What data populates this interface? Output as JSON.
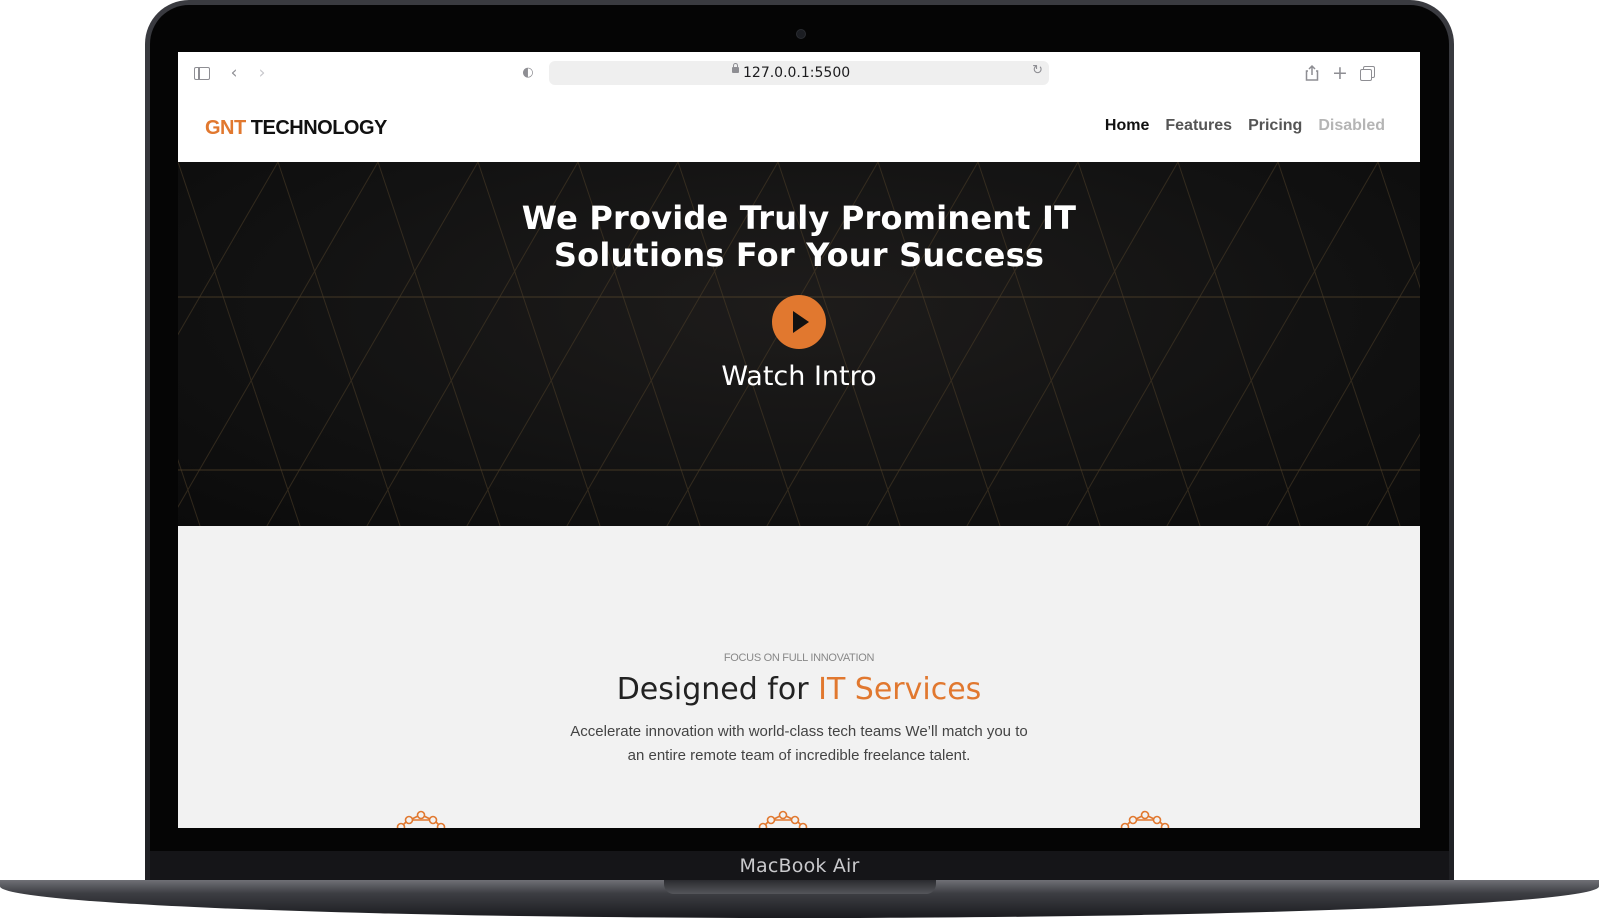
{
  "device": {
    "label": "MacBook Air"
  },
  "browser": {
    "url": "127.0.0.1:5500",
    "icons": [
      "sidebar-icon",
      "back-icon",
      "forward-icon",
      "shield-icon",
      "lock-icon",
      "reload-icon",
      "share-icon",
      "new-tab-icon",
      "tabs-overview-icon"
    ]
  },
  "navbar": {
    "logo_accent": "GNT",
    "logo_rest": " TECHNOLOGY",
    "links": [
      {
        "label": "Home",
        "state": "active"
      },
      {
        "label": "Features",
        "state": "default"
      },
      {
        "label": "Pricing",
        "state": "default"
      },
      {
        "label": "Disabled",
        "state": "disabled"
      }
    ]
  },
  "hero": {
    "title_line1": "We Provide Truly Prominent IT",
    "title_line2": "Solutions For Your Success",
    "cta_label": "Watch Intro"
  },
  "features": {
    "eyebrow": "FOCUS ON FULL INNOVATION",
    "title_plain": "Designed for ",
    "title_accent": "IT Services",
    "desc_line1": "Accelerate innovation with world-class tech teams We’ll match you to",
    "desc_line2": "an entire remote team of incredible freelance talent.",
    "icon_count": 3
  },
  "colors": {
    "accent": "#e1782f",
    "hero_bg": "#121212",
    "section_bg": "#f2f2f2"
  }
}
